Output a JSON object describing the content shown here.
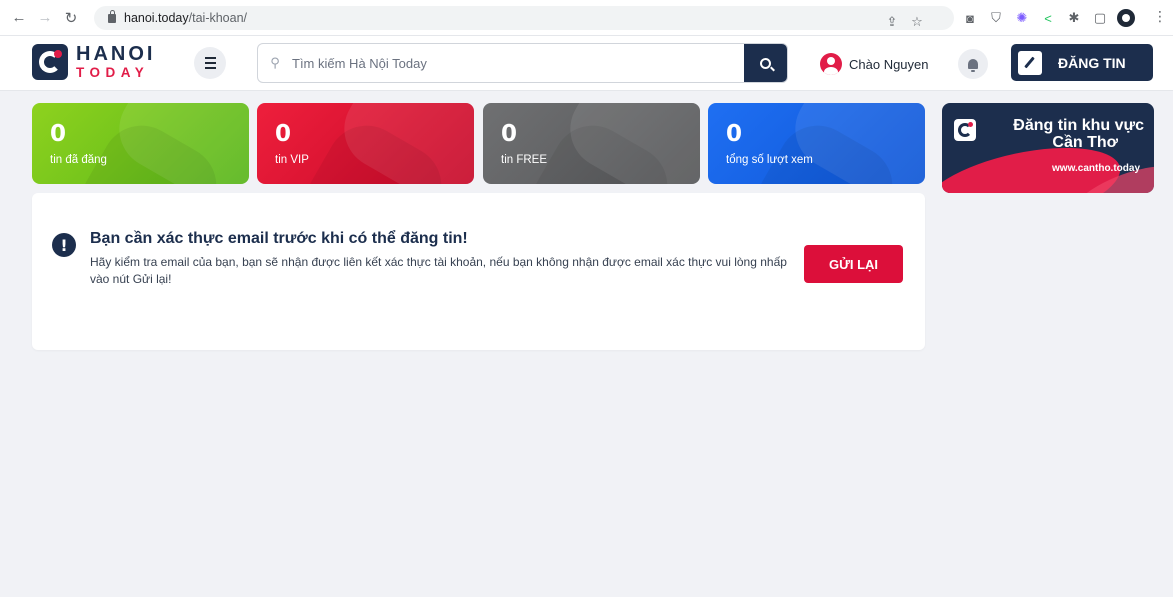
{
  "browser": {
    "url_host": "hanoi.today",
    "url_path": "/tai-khoan/"
  },
  "header": {
    "logo_line1": "HANOI",
    "logo_line2": "TODAY",
    "search_placeholder": "Tìm kiếm Hà Nội Today",
    "greeting": "Chào Nguyen",
    "post_button": "ĐĂNG TIN"
  },
  "stats": [
    {
      "value": "0",
      "label": "tin đã đăng",
      "color": "#7cc11c"
    },
    {
      "value": "0",
      "label": "tin VIP",
      "color": "#e3112e"
    },
    {
      "value": "0",
      "label": "tin FREE",
      "color": "#626365"
    },
    {
      "value": "0",
      "label": "tổng số lượt xem",
      "color": "#1563e6"
    }
  ],
  "promo": {
    "line1": "Đăng tin khu vực",
    "line2": "Cần Thơ",
    "url": "www.cantho.today"
  },
  "alert": {
    "title": "Bạn cần xác thực email trước khi có thể đăng tin!",
    "body": "Hãy kiểm tra email của bạn, bạn sẽ nhận được liên kết xác thực tài khoản, nếu bạn không nhận được email xác thực vui lòng nhấp vào nút Gửi lại!",
    "button": "GỬI LẠI"
  },
  "colors": {
    "brand_navy": "#1c2e4d",
    "brand_red": "#e11d48",
    "page_bg": "#f1f2f6"
  }
}
